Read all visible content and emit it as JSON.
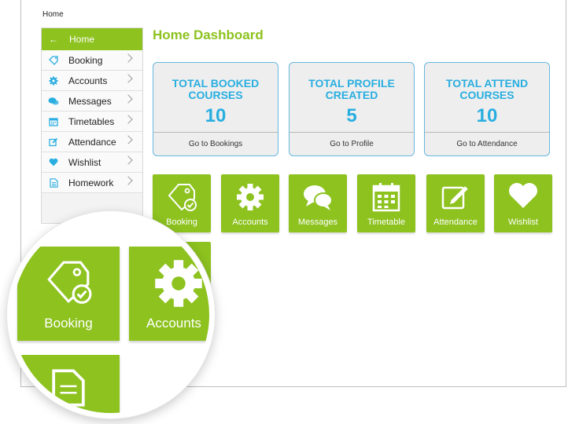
{
  "breadcrumb": "Home",
  "sidebar": {
    "home": "Home",
    "items": [
      {
        "label": "Booking",
        "icon": "tag-check-icon"
      },
      {
        "label": "Accounts",
        "icon": "gear-icon"
      },
      {
        "label": "Messages",
        "icon": "chat-bubbles-icon"
      },
      {
        "label": "Timetables",
        "icon": "calendar-icon"
      },
      {
        "label": "Attendance",
        "icon": "edit-icon"
      },
      {
        "label": "Wishlist",
        "icon": "heart-icon"
      },
      {
        "label": "Homework",
        "icon": "document-icon"
      }
    ]
  },
  "main": {
    "title": "Home Dashboard",
    "stats": [
      {
        "title": "TOTAL BOOKED COURSES",
        "value": "10",
        "link": "Go to Bookings"
      },
      {
        "title": "TOTAL PROFILE CREATED",
        "value": "5",
        "link": "Go to Profile"
      },
      {
        "title": "TOTAL ATTEND COURSES",
        "value": "10",
        "link": "Go to Attendance"
      }
    ],
    "tiles": [
      "Booking",
      "Accounts",
      "Messages",
      "Timetable",
      "Attendance",
      "Wishlist"
    ]
  },
  "zoom": {
    "tiles": [
      "Booking",
      "Accounts"
    ]
  },
  "colors": {
    "brand_green": "#8dc21f",
    "stat_blue": "#28aee0",
    "stat_border": "#67b8df"
  }
}
